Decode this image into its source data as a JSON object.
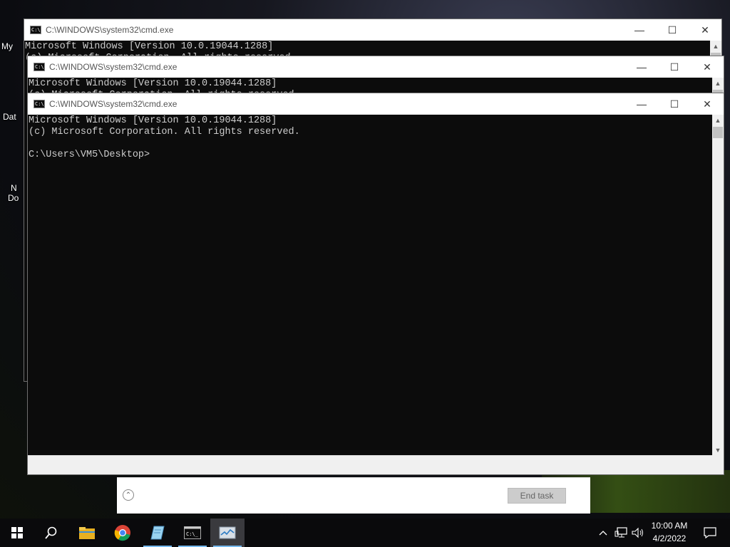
{
  "desktop": {
    "icon_labels": [
      "My",
      "Dat",
      "N",
      "Do"
    ]
  },
  "task_manager": {
    "end_task_label": "End task",
    "fewer_details_glyph": "⌃"
  },
  "windows": [
    {
      "title": "C:\\WINDOWS\\system32\\cmd.exe",
      "lines": [
        "Microsoft Windows [Version 10.0.19044.1288]",
        "(c) Microsoft Corporation. All rights reserved."
      ]
    },
    {
      "title": "C:\\WINDOWS\\system32\\cmd.exe",
      "lines": [
        "Microsoft Windows [Version 10.0.19044.1288]",
        "(c) Microsoft Corporation. All rights reserved."
      ]
    },
    {
      "title": "C:\\WINDOWS\\system32\\cmd.exe",
      "lines": [
        "Microsoft Windows [Version 10.0.19044.1288]",
        "(c) Microsoft Corporation. All rights reserved.",
        "",
        "C:\\Users\\VM5\\Desktop>"
      ]
    }
  ],
  "title_buttons": {
    "minimize": "—",
    "maximize": "☐",
    "close": "✕"
  },
  "taskbar": {
    "apps": [
      "start-icon",
      "search-icon",
      "file-explorer-icon",
      "chrome-icon",
      "notepad-icon",
      "cmd-icon",
      "task-manager-icon"
    ],
    "time": "10:00 AM",
    "date": "4/2/2022"
  }
}
